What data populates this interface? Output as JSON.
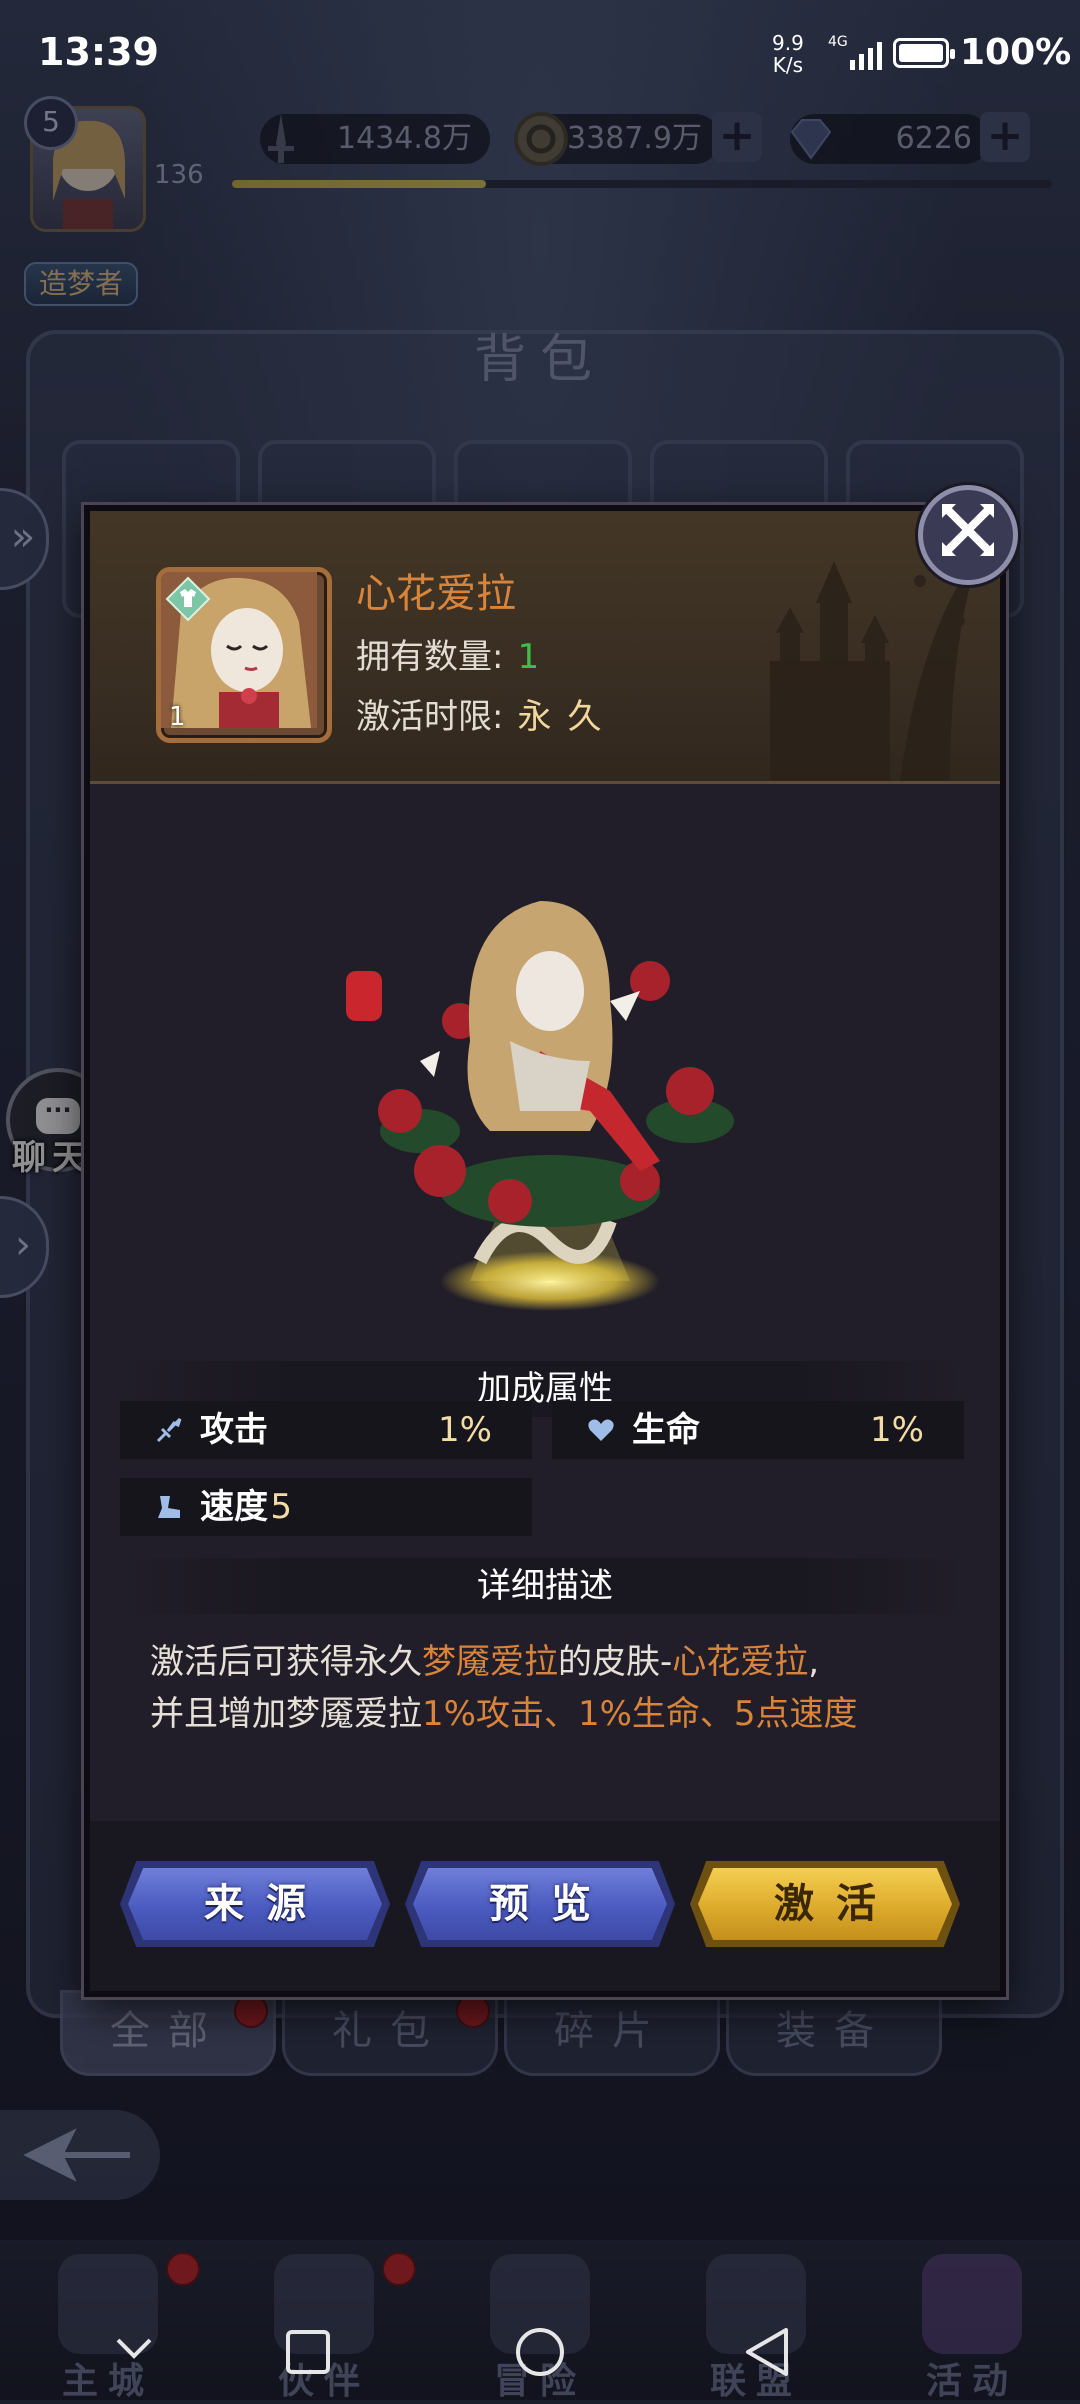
{
  "status_bar": {
    "time": "13:39",
    "net_speed_value": "9.9",
    "net_speed_unit": "K/s",
    "signal_label": "4G",
    "battery": "100%"
  },
  "player": {
    "avatar_level": "5",
    "level": "136",
    "title": "造梦者",
    "xp_fraction": 0.31
  },
  "resources": {
    "power": "1434.8万",
    "gold": "3387.9万",
    "diamonds": "6226",
    "plus": "+"
  },
  "background": {
    "bag_title": "背包",
    "chat_label": "聊天",
    "categories": [
      {
        "label": "全部",
        "active": true
      },
      {
        "label": "礼包",
        "active": false
      },
      {
        "label": "碎片",
        "active": false
      },
      {
        "label": "装备",
        "active": false
      }
    ],
    "bottom_nav": [
      "主城",
      "伙伴",
      "冒险",
      "联盟",
      "活动"
    ]
  },
  "modal": {
    "item_name": "心花爱拉",
    "item_count_badge": "1",
    "owned_label": "拥有数量:",
    "owned_value": "1",
    "duration_label": "激活时限:",
    "duration_value": "永久",
    "close_icon": "✕",
    "bonus_title": "加成属性",
    "attributes": [
      {
        "icon": "attack-icon",
        "label": "攻击",
        "value": "1%"
      },
      {
        "icon": "heart-icon",
        "label": "生命",
        "value": "1%"
      },
      {
        "icon": "speed-icon",
        "label": "速度",
        "value": "5"
      }
    ],
    "detail_title": "详细描述",
    "description": {
      "p1": "激活后可获得永久",
      "hl1": "梦魇爱拉",
      "p2": "的皮肤-",
      "hl2": "心花爱拉",
      "p3": ",",
      "p4": "并且增加梦魇爱拉",
      "hl3": "1%攻击、1%生命、5点速度"
    },
    "buttons": {
      "source": "来源",
      "preview": "预览",
      "activate": "激活"
    }
  },
  "colors": {
    "accent_orange": "#d8843a",
    "value_gold": "#f3dda6",
    "owned_green": "#3fbf4a",
    "button_blue": "#5565c8",
    "button_gold": "#e2b132"
  }
}
